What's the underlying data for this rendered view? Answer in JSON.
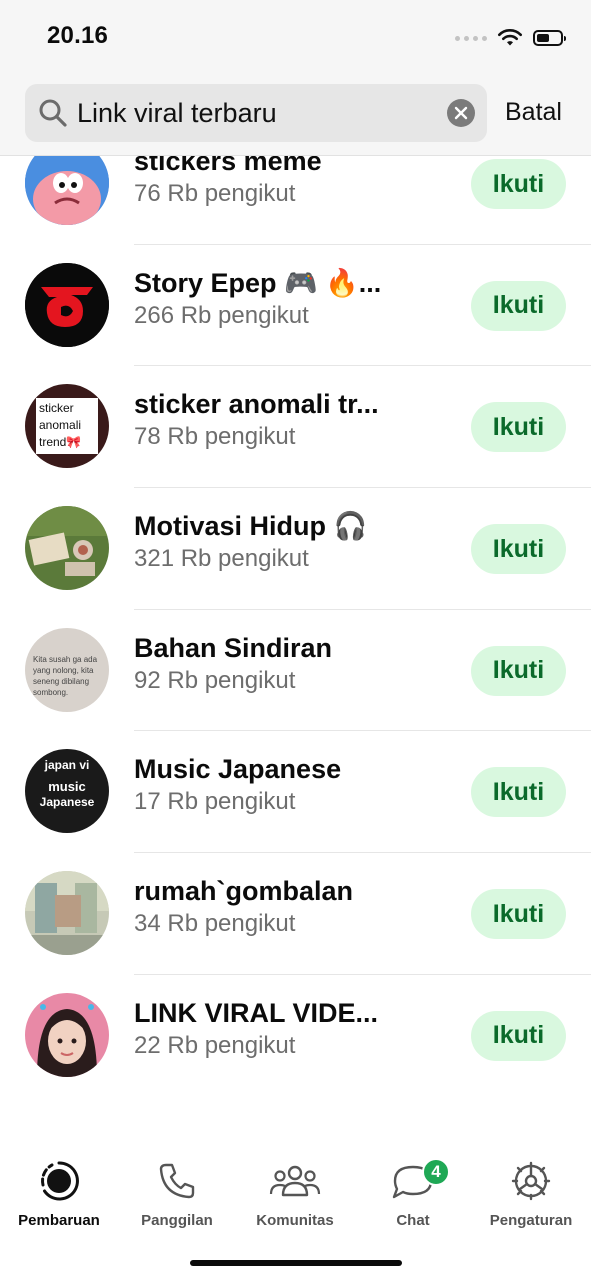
{
  "status_bar": {
    "time": "20.16"
  },
  "search": {
    "query": "Link viral terbaru",
    "cancel_label": "Batal"
  },
  "follow_label": "Ikuti",
  "channels": [
    {
      "name": "stickers meme",
      "followers": "76 Rb pengikut"
    },
    {
      "name": "Story Epep 🎮 🔥...",
      "followers": "266 Rb pengikut"
    },
    {
      "name": "sticker anomali tr...",
      "followers": "78 Rb pengikut"
    },
    {
      "name": "Motivasi Hidup 🎧",
      "followers": "321 Rb pengikut"
    },
    {
      "name": "Bahan Sindiran",
      "followers": "92 Rb pengikut"
    },
    {
      "name": "Music Japanese",
      "followers": "17 Rb pengikut"
    },
    {
      "name": "rumah`gombalan",
      "followers": "34 Rb pengikut"
    },
    {
      "name": "LINK VIRAL VIDE...",
      "followers": "22 Rb pengikut"
    }
  ],
  "avatar_texts": {
    "sticker_anomali": [
      "sticker",
      "anomali",
      "trend🎀"
    ],
    "bahan_sindiran": "Kita susah ga ada yang nolong, kita seneng dibilang sombong.",
    "music_japanese": [
      "japan vi",
      "music",
      "Japanese"
    ]
  },
  "tabs": [
    {
      "label": "Pembaruan",
      "icon": "updates-icon",
      "active": true
    },
    {
      "label": "Panggilan",
      "icon": "phone-icon"
    },
    {
      "label": "Komunitas",
      "icon": "community-icon"
    },
    {
      "label": "Chat",
      "icon": "chat-icon",
      "badge": "4"
    },
    {
      "label": "Pengaturan",
      "icon": "settings-icon"
    }
  ],
  "colors": {
    "accent_green": "#1fa855",
    "follow_bg": "#d9f8df",
    "follow_text": "#0b6a2b"
  }
}
